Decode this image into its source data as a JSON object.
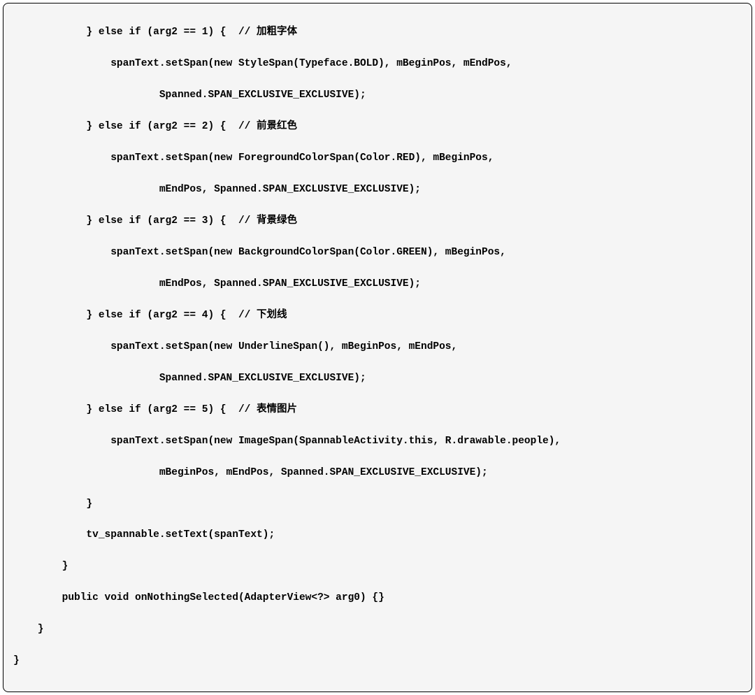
{
  "code": {
    "lines": [
      "            } else if (arg2 == 1) {  // 加粗字体",
      "                spanText.setSpan(new StyleSpan(Typeface.BOLD), mBeginPos, mEndPos,",
      "                        Spanned.SPAN_EXCLUSIVE_EXCLUSIVE);",
      "            } else if (arg2 == 2) {  // 前景红色",
      "                spanText.setSpan(new ForegroundColorSpan(Color.RED), mBeginPos,",
      "                        mEndPos, Spanned.SPAN_EXCLUSIVE_EXCLUSIVE);",
      "            } else if (arg2 == 3) {  // 背景绿色",
      "                spanText.setSpan(new BackgroundColorSpan(Color.GREEN), mBeginPos,",
      "                        mEndPos, Spanned.SPAN_EXCLUSIVE_EXCLUSIVE);",
      "            } else if (arg2 == 4) {  // 下划线",
      "                spanText.setSpan(new UnderlineSpan(), mBeginPos, mEndPos,",
      "                        Spanned.SPAN_EXCLUSIVE_EXCLUSIVE);",
      "            } else if (arg2 == 5) {  // 表情图片",
      "                spanText.setSpan(new ImageSpan(SpannableActivity.this, R.drawable.people),",
      "                        mBeginPos, mEndPos, Spanned.SPAN_EXCLUSIVE_EXCLUSIVE);",
      "            }",
      "            tv_spannable.setText(spanText);",
      "        }",
      "        public void onNothingSelected(AdapterView<?> arg0) {}",
      "    }",
      "}"
    ]
  }
}
